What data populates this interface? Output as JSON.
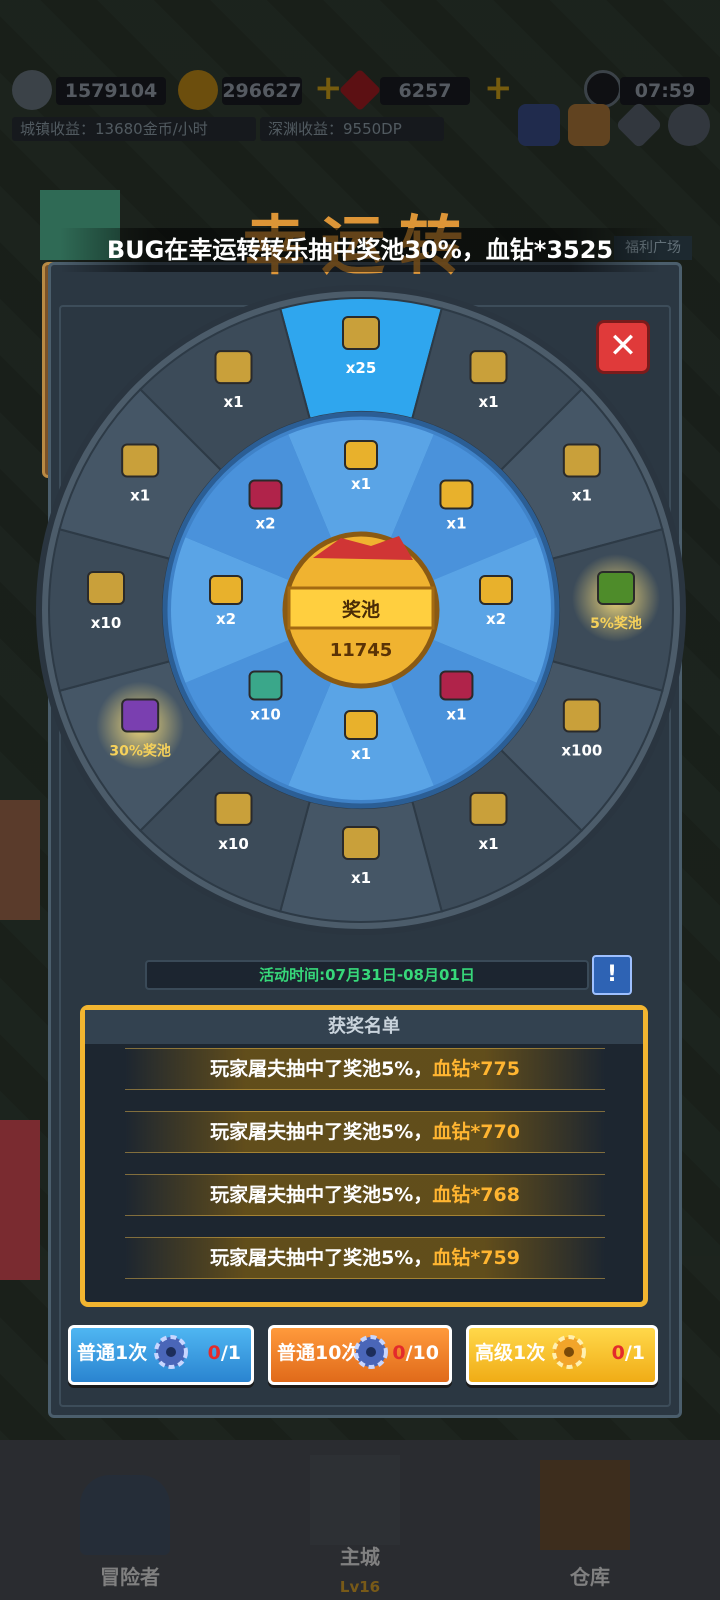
{
  "top_bar": {
    "power": "1579104",
    "gold": "296627",
    "gems": "6257",
    "time": "07:59",
    "town_income": "城镇收益：13680金币/小时",
    "abyss_income": "深渊收益：9550DP"
  },
  "side": {
    "welfare": "福利广场"
  },
  "title": "幸运转转乐",
  "marquee": "BUG在幸运转转乐抽中奖池30%，血钻*3525",
  "close_icon": "close-icon",
  "wheel": {
    "center_label": "奖池",
    "pool_value": "11745",
    "outer": [
      {
        "label": "x25",
        "icon": "box-icon"
      },
      {
        "label": "x1",
        "icon": "blue-gem-icon"
      },
      {
        "label": "x1",
        "icon": "dark-crystal-icon"
      },
      {
        "label": "5%奖池",
        "icon": "green-chest-icon"
      },
      {
        "label": "x100",
        "icon": "rainbow-orb-icon"
      },
      {
        "label": "x1",
        "icon": "scroll-bundle-icon"
      },
      {
        "label": "x1",
        "icon": "gold-ticket-icon"
      },
      {
        "label": "x10",
        "icon": "potion-icon"
      },
      {
        "label": "30%奖池",
        "icon": "purple-chest-icon"
      },
      {
        "label": "x10",
        "icon": "paper-scroll-icon"
      },
      {
        "label": "x1",
        "icon": "tag-icon"
      },
      {
        "label": "x1",
        "icon": "gold-gear-icon"
      }
    ],
    "inner": [
      {
        "label": "x1",
        "icon": "gold-boot-icon"
      },
      {
        "label": "x1",
        "icon": "potion-bag-icon"
      },
      {
        "label": "x2",
        "icon": "gold-boot-icon"
      },
      {
        "label": "x1",
        "icon": "red-envelope-icon"
      },
      {
        "label": "x1",
        "icon": "gold-medal-icon"
      },
      {
        "label": "x10",
        "icon": "green-envelope-icon"
      },
      {
        "label": "x2",
        "icon": "gold-medal-icon"
      },
      {
        "label": "x2",
        "icon": "red-envelope-icon"
      }
    ]
  },
  "event_time": "活动时间:07月31日-08月01日",
  "info_label": "!",
  "winners": {
    "title": "获奖名单",
    "rows": [
      {
        "text": "玩家屠夫抽中了奖池5%，",
        "reward": "血钻*775"
      },
      {
        "text": "玩家屠夫抽中了奖池5%，",
        "reward": "血钻*770"
      },
      {
        "text": "玩家屠夫抽中了奖池5%，",
        "reward": "血钻*768"
      },
      {
        "text": "玩家屠夫抽中了奖池5%，",
        "reward": "血钻*759"
      }
    ]
  },
  "buttons": [
    {
      "label": "普通1次",
      "have": "0",
      "need": "/1"
    },
    {
      "label": "普通10次",
      "have": "0",
      "need": "/10"
    },
    {
      "label": "高级1次",
      "have": "0",
      "need": "/1"
    }
  ],
  "nav": [
    {
      "label": "冒险者"
    },
    {
      "label": "主城",
      "sub": "Lv16"
    },
    {
      "label": "仓库"
    }
  ],
  "colors": {
    "accent_gold": "#f2b530",
    "highlight_orange": "#ffb531",
    "timer_green": "#37d87a",
    "wheel_inner": "#4a90d9",
    "wheel_outer": "#3b4b5a"
  }
}
